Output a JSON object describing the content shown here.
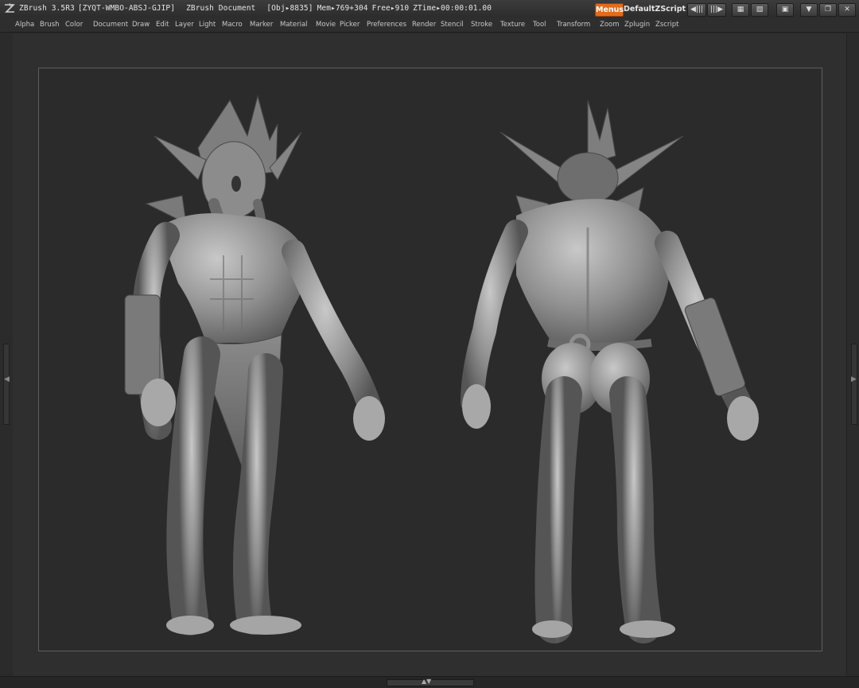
{
  "titlebar": {
    "app": "ZBrush 3.5R3",
    "serial": "[ZYQT-WMBO-ABSJ-GJIP]",
    "document": "ZBrush Document",
    "obj": "[Obj▸8835]",
    "mem": "Mem▸769+304",
    "free": "Free▸910",
    "ztime": "ZTime▸00:00:01.00",
    "menus_button": "Menus",
    "script_label": "DefaultZScript"
  },
  "menubar": {
    "items": [
      "Alpha",
      "Brush",
      "Color",
      "Document",
      "Draw",
      "Edit",
      "Layer",
      "Light",
      "Macro",
      "Marker",
      "Material",
      "Movie",
      "Picker",
      "Preferences",
      "Render",
      "Stencil",
      "Stroke",
      "Texture",
      "Tool",
      "Transform",
      "Zoom",
      "Zplugin",
      "Zscript"
    ]
  },
  "icons": {
    "logo": "zbrush-logo-icon",
    "minimize": "minimize-icon",
    "restore": "restore-icon",
    "close": "close-icon"
  },
  "colors": {
    "accent": "#e46b1a",
    "background": "#2b2b2b",
    "model": "#9a9a9a"
  }
}
